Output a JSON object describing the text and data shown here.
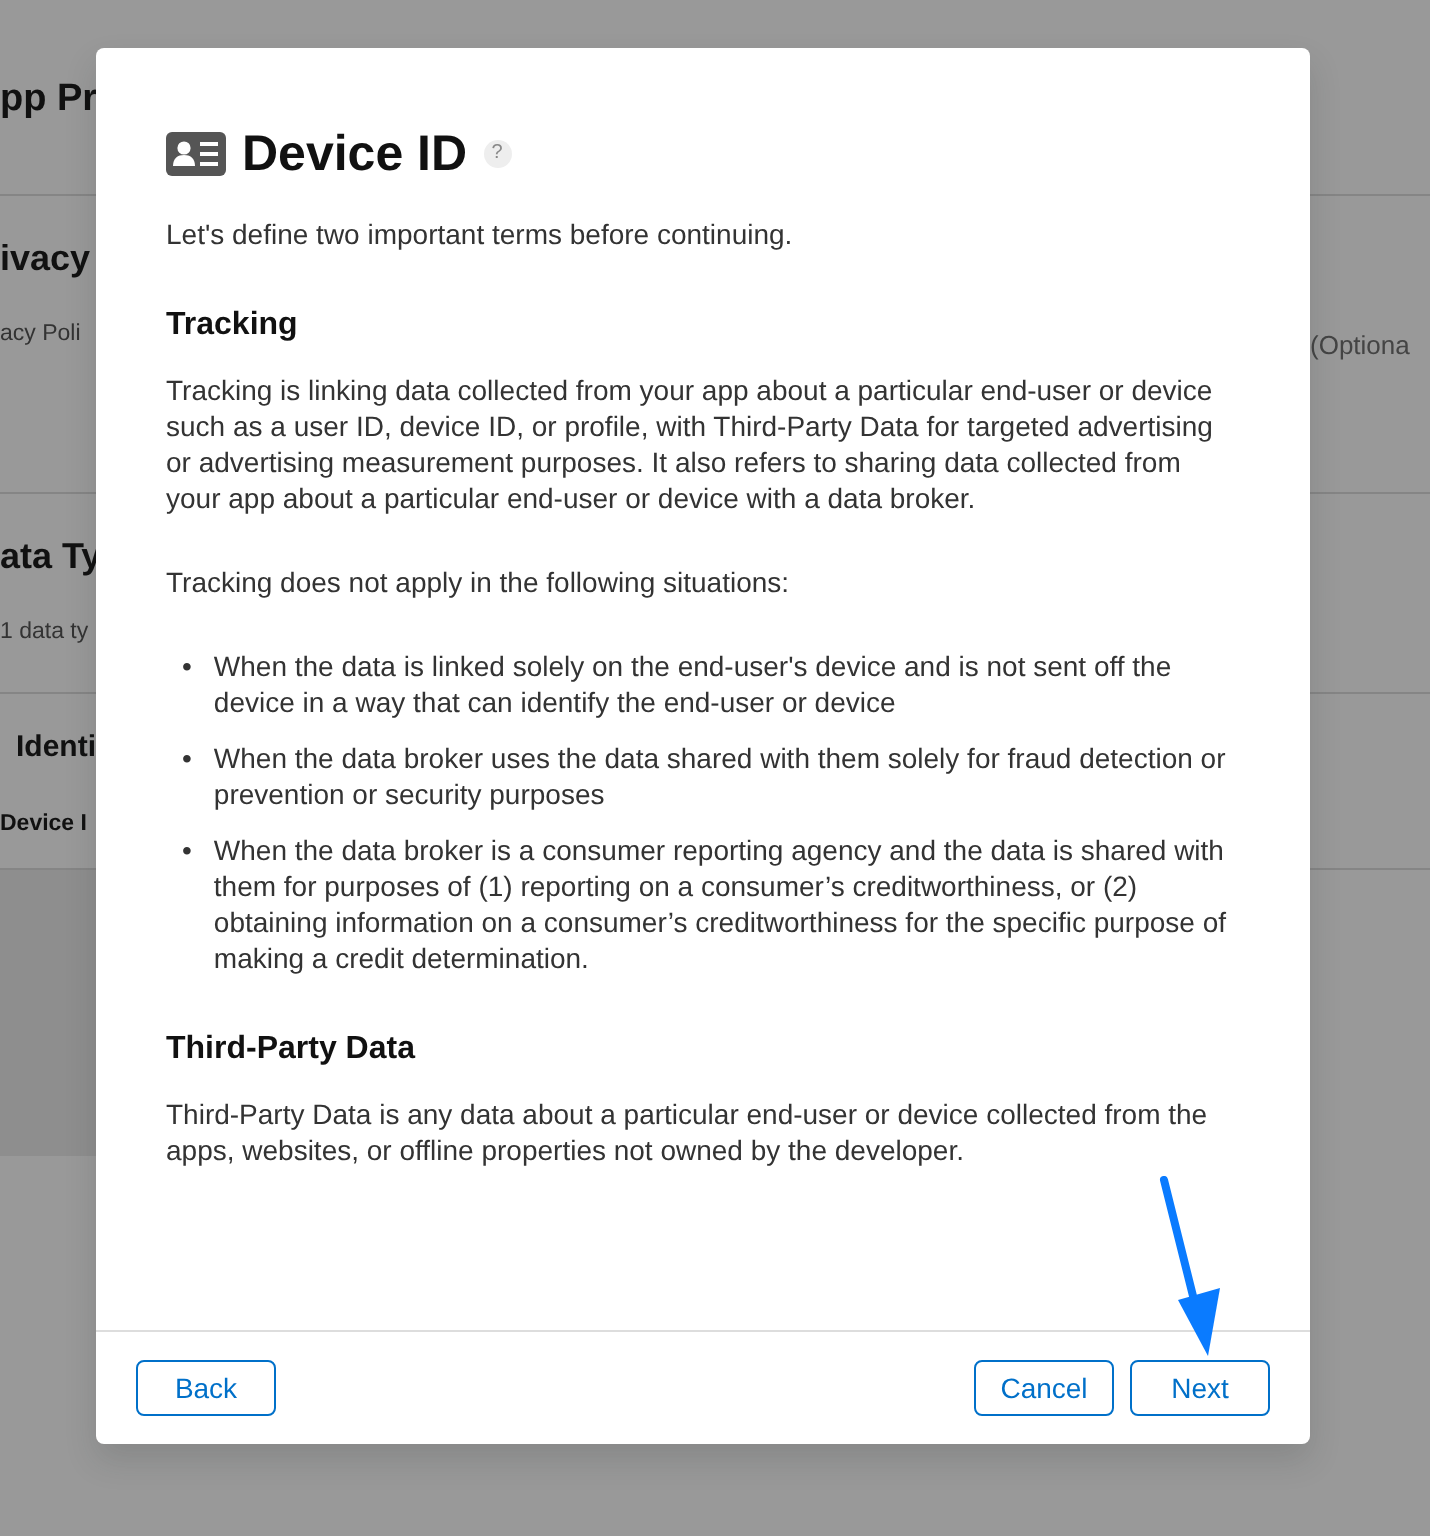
{
  "background": {
    "sections": [
      {
        "left": [
          {
            "kind": "title",
            "text": "pp Pr"
          }
        ]
      },
      {
        "left": [
          {
            "kind": "heading",
            "text": "ivacy"
          },
          {
            "kind": "text",
            "text": "acy Poli"
          }
        ],
        "right": [
          {
            "kind": "text",
            "text": "(Optiona"
          }
        ]
      },
      {
        "left": [
          {
            "kind": "heading",
            "text": "ata Ty"
          },
          {
            "kind": "text",
            "text": "1 data ty"
          }
        ]
      },
      {
        "left": [
          {
            "kind": "subheading",
            "text": "Identi"
          },
          {
            "kind": "label",
            "text": "Device I"
          }
        ]
      }
    ]
  },
  "modal": {
    "title": "Device ID",
    "help": "?",
    "intro": "Let's define two important terms before continuing.",
    "sections": [
      {
        "heading": "Tracking",
        "blocks": [
          {
            "kind": "paragraph",
            "text": "Tracking is linking data collected from your app about a particular end-user or device such as a user ID, device ID, or profile, with Third-Party Data for targeted advertising or advertising measurement purposes. It also refers to sharing data collected from your app about a particular end-user or device with a data broker."
          },
          {
            "kind": "paragraph",
            "text": "Tracking does not apply in the following situations:"
          },
          {
            "kind": "bullets",
            "items": [
              {
                "marker": "•",
                "text": "When the data is linked solely on the end-user's device and is not sent off the device in a way that can identify the end-user or device"
              },
              {
                "marker": "•",
                "text": "When the data broker uses the data shared with them solely for fraud detection or prevention or security purposes"
              },
              {
                "marker": "•",
                "text": "When the data broker is a consumer reporting agency and the data is shared with them for purposes of (1) reporting on a consumer’s creditworthiness, or (2) obtaining information on a consumer’s creditworthiness for the specific purpose of making a credit determination."
              }
            ]
          }
        ]
      },
      {
        "heading": "Third-Party Data",
        "blocks": [
          {
            "kind": "paragraph",
            "text": "Third-Party Data is any data about a particular end-user or device collected from the apps, websites, or offline properties not owned by the developer."
          }
        ]
      }
    ],
    "footer": {
      "left_buttons": [
        "Back"
      ],
      "right_buttons": [
        "Cancel",
        "Next"
      ]
    }
  }
}
